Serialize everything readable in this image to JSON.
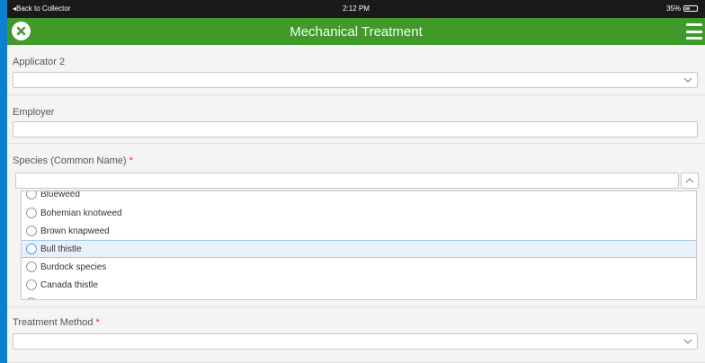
{
  "statusbar": {
    "back_label": "◂Back to Collector",
    "time": "2:12 PM",
    "battery": "35%"
  },
  "header": {
    "title": "Mechanical Treatment"
  },
  "fields": {
    "applicator2": {
      "label": "Applicator 2",
      "value": ""
    },
    "employer": {
      "label": "Employer",
      "value": ""
    },
    "species": {
      "label": "Species (Common Name)",
      "required_mark": "*",
      "value": ""
    },
    "treatment": {
      "label": "Treatment Method",
      "required_mark": "*",
      "value": ""
    }
  },
  "species_options": [
    {
      "label": "Blueweed",
      "selected": false
    },
    {
      "label": "Bohemian knotweed",
      "selected": false
    },
    {
      "label": "Brown knapweed",
      "selected": false
    },
    {
      "label": "Bull thistle",
      "selected": true
    },
    {
      "label": "Burdock species",
      "selected": false
    },
    {
      "label": "Canada thistle",
      "selected": false
    }
  ],
  "colors": {
    "header": "#3f9a2a",
    "frame": "#0d7fd0",
    "required": "#d93025",
    "selected_row": "#e8f1fb"
  }
}
